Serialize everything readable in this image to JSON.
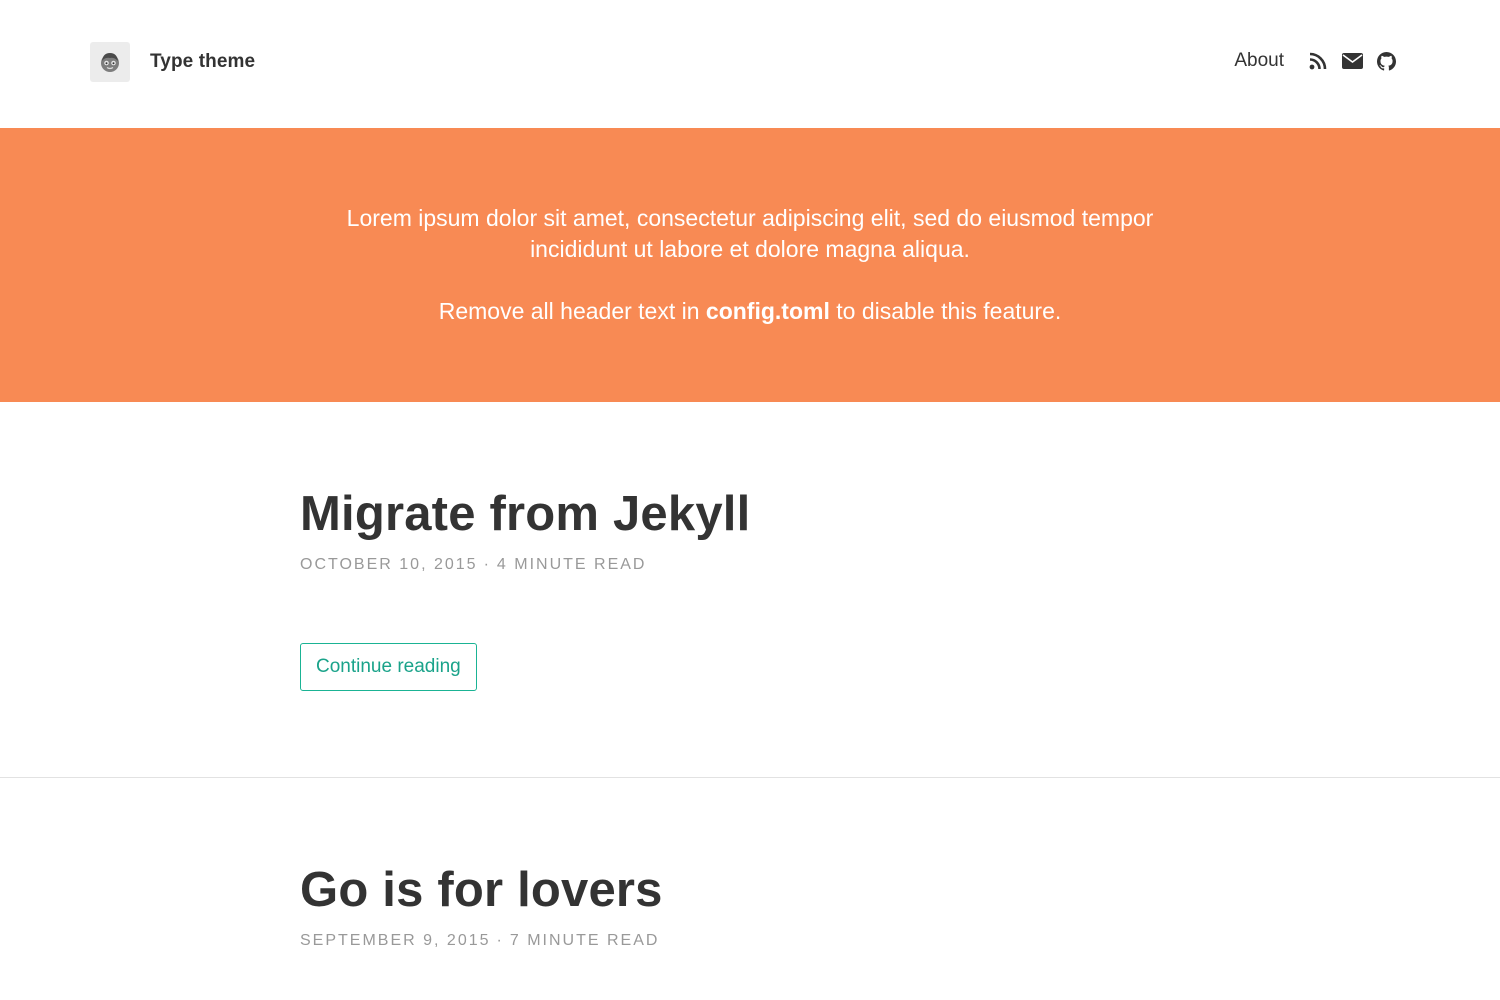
{
  "site": {
    "title": "Type theme"
  },
  "nav": {
    "about_label": "About",
    "icons": [
      "rss-icon",
      "envelope-icon",
      "github-icon"
    ]
  },
  "hero": {
    "description": "Lorem ipsum dolor sit amet, consectetur adipiscing elit, sed do eiusmod tempor incididunt ut labore et dolore magna aliqua.",
    "note_prefix": "Remove all header text in ",
    "note_file": "config.toml",
    "note_suffix": " to disable this feature."
  },
  "colors": {
    "hero_background": "#f88a54",
    "accent": "#1ab394",
    "text": "#333333",
    "meta": "#999999"
  },
  "posts": [
    {
      "title": "Migrate from Jekyll",
      "date": "October 10, 2015",
      "separator": "·",
      "reading_time": "4 minute read",
      "continue_label": "Continue reading"
    },
    {
      "title": "Go is for lovers",
      "date": "September 9, 2015",
      "separator": "·",
      "reading_time": "7 minute read"
    }
  ]
}
